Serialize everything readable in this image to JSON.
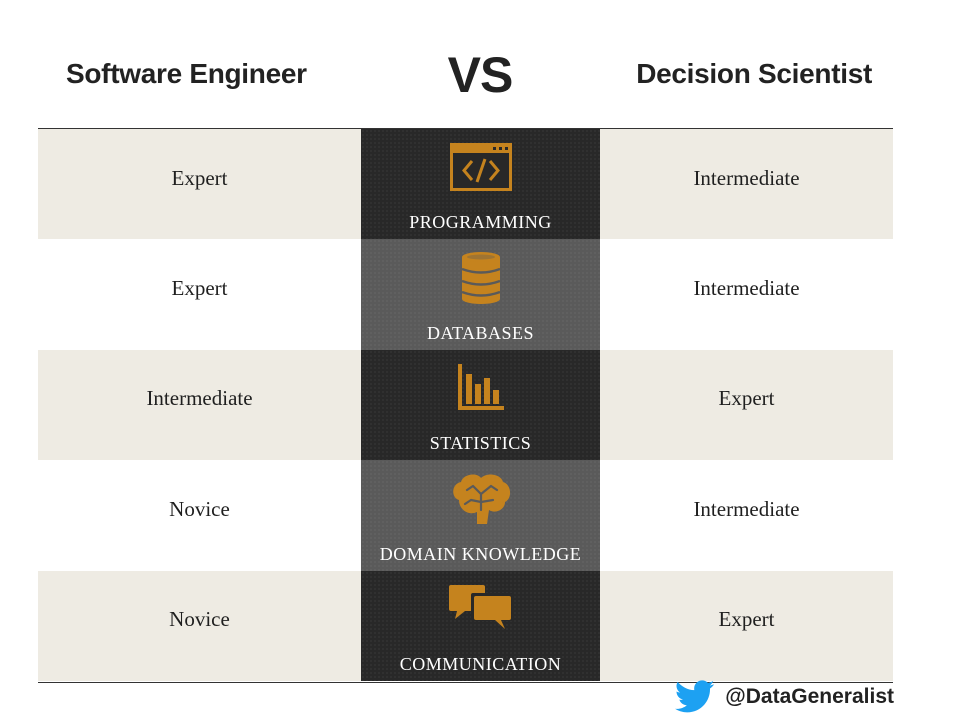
{
  "header": {
    "left_title": "Software Engineer",
    "vs": "VS",
    "right_title": "Decision Scientist"
  },
  "rows": [
    {
      "left": "Expert",
      "skill": "PROGRAMMING",
      "right": "Intermediate",
      "icon": "code-window-icon"
    },
    {
      "left": "Expert",
      "skill": "DATABASES",
      "right": "Intermediate",
      "icon": "database-icon"
    },
    {
      "left": "Intermediate",
      "skill": "STATISTICS",
      "right": "Expert",
      "icon": "bar-chart-icon"
    },
    {
      "left": "Novice",
      "skill": "DOMAIN KNOWLEDGE",
      "right": "Intermediate",
      "icon": "brain-icon"
    },
    {
      "left": "Novice",
      "skill": "COMMUNICATION",
      "right": "Expert",
      "icon": "chat-bubbles-icon"
    }
  ],
  "footer": {
    "handle": "@DataGeneralist",
    "icon": "twitter-bird-icon"
  },
  "colors": {
    "icon": "#c5831e",
    "dark_cell": "#282828",
    "gray_cell": "#5a5a5a",
    "beige_row": "#eeebe3",
    "twitter_blue": "#1da1f2"
  }
}
